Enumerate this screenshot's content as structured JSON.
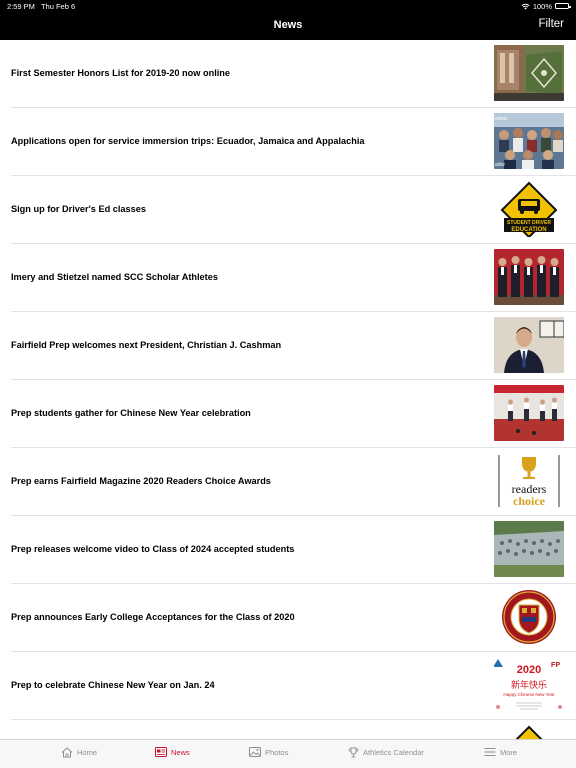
{
  "status_bar": {
    "time": "2:59 PM",
    "date": "Thu Feb 6",
    "battery": "100%"
  },
  "nav": {
    "title": "News",
    "filter_label": "Filter"
  },
  "articles": [
    {
      "headline": "First Semester Honors List for 2019-20 now online"
    },
    {
      "headline": "Applications open for service immersion trips: Ecuador, Jamaica and Appalachia",
      "thumb_text": [
        "onica",
        "ador"
      ]
    },
    {
      "headline": "Sign up for Driver's Ed classes",
      "thumb_text": [
        "STUDENT DRIVER",
        "EDUCATION"
      ]
    },
    {
      "headline": "Imery and Stietzel named SCC Scholar Athletes"
    },
    {
      "headline": "Fairfield Prep welcomes next President, Christian J. Cashman"
    },
    {
      "headline": "Prep students gather for Chinese New Year celebration"
    },
    {
      "headline": "Prep earns Fairfield Magazine 2020 Readers Choice Awards",
      "thumb_text": [
        "readers",
        "choice"
      ]
    },
    {
      "headline": "Prep releases welcome video to Class of 2024 accepted students"
    },
    {
      "headline": "Prep announces Early College Acceptances for the Class of 2020"
    },
    {
      "headline": "Prep to celebrate Chinese New Year on Jan. 24",
      "thumb_text": [
        "2020",
        "新年快乐",
        "Happy Chinese New Year",
        "FP"
      ]
    }
  ],
  "tabs": [
    {
      "label": "Home",
      "icon": "home-icon",
      "active": false
    },
    {
      "label": "News",
      "icon": "news-icon",
      "active": true
    },
    {
      "label": "Photos",
      "icon": "photos-icon",
      "active": false
    },
    {
      "label": "Athletics Calendar",
      "icon": "trophy-icon",
      "active": false
    },
    {
      "label": "More",
      "icon": "menu-icon",
      "active": false
    }
  ],
  "colors": {
    "bar": "#000000",
    "accent": "#c8102e",
    "tab_inactive": "#8e8e93",
    "divider": "#e3e3e3"
  }
}
